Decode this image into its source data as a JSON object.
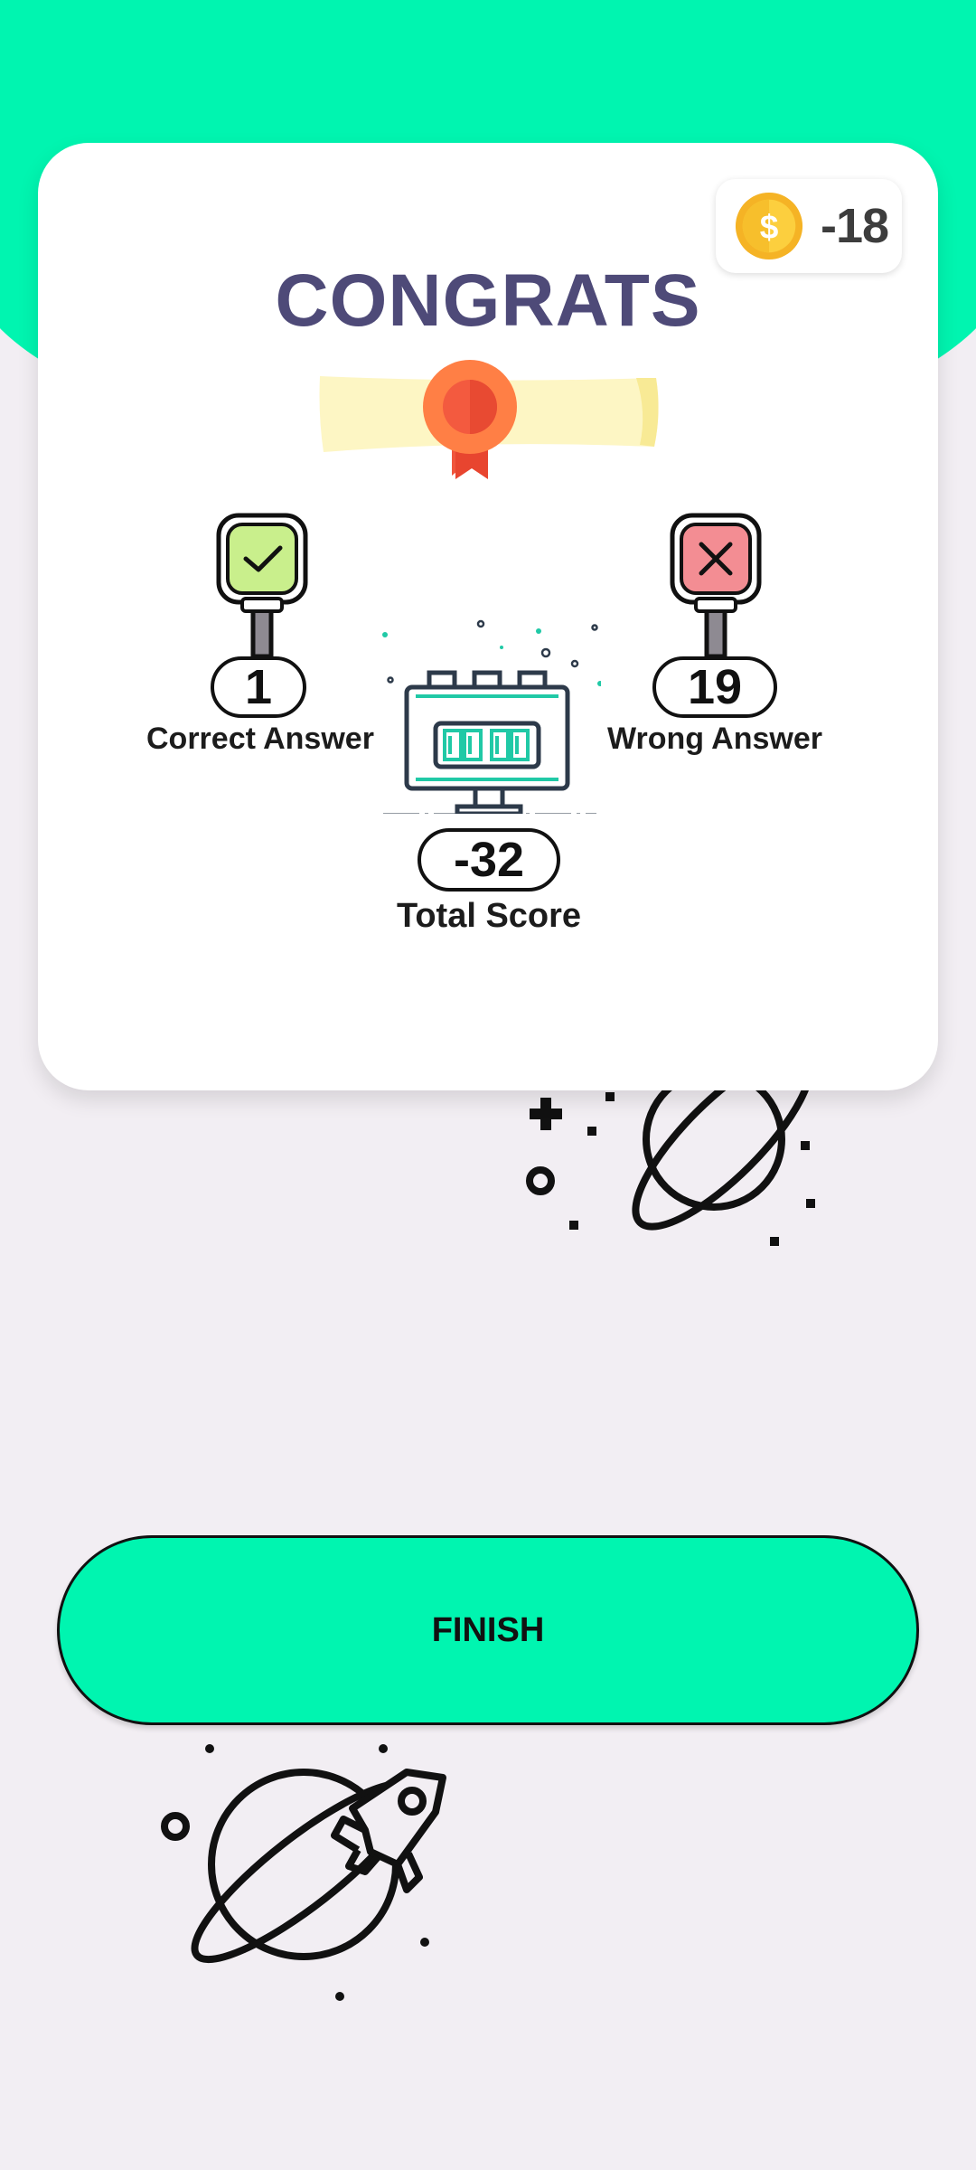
{
  "coins": {
    "value": "-18",
    "icon": "coin-dollar-icon"
  },
  "result": {
    "title": "CONGRATS",
    "correct": {
      "value": "1",
      "label": "Correct Answer",
      "icon": "check-sign-icon"
    },
    "wrong": {
      "value": "19",
      "label": "Wrong Answer",
      "icon": "cross-sign-icon"
    },
    "total": {
      "value": "-32",
      "label": "Total Score",
      "icon": "scoreboard-icon"
    }
  },
  "finish_button": {
    "label": "FINISH"
  },
  "colors": {
    "accent": "#00f5b0",
    "background": "#f2eef3",
    "title": "#4e4a78",
    "correct": "#c9ef8c",
    "wrong": "#f38d93"
  }
}
